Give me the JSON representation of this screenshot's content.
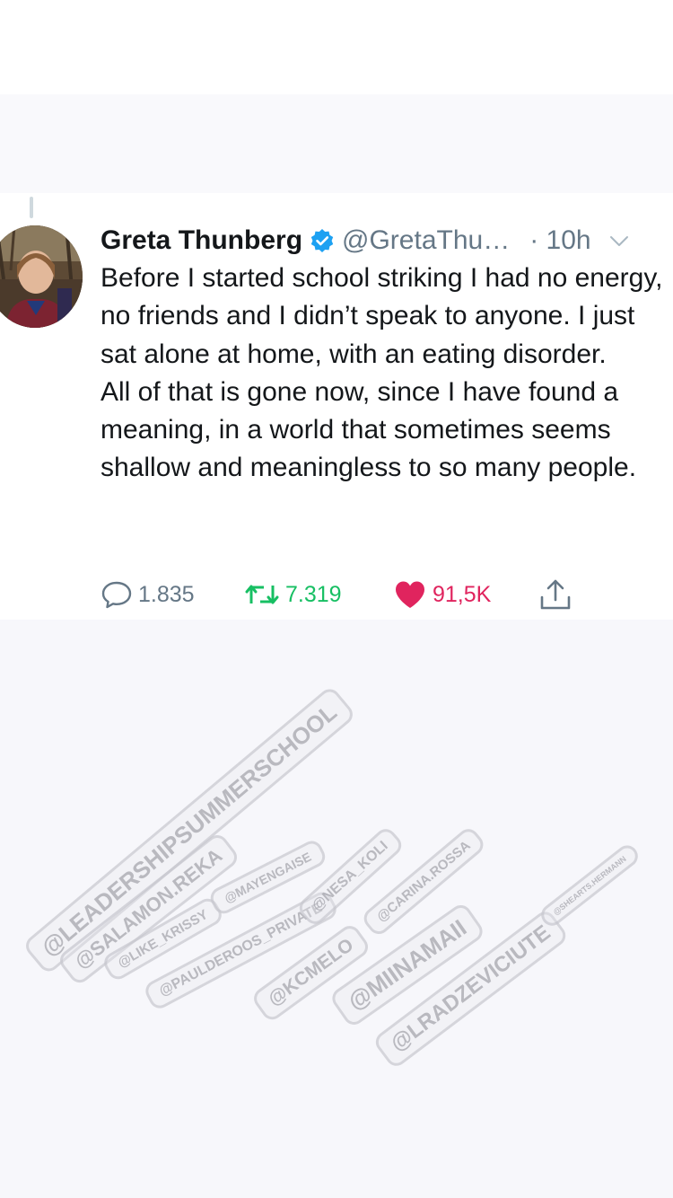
{
  "tweet": {
    "author_name": "Greta Thunberg",
    "handle": "@GretaThu…",
    "time": "· 10h",
    "text": "Before I started school striking I had no energy, no friends and I didn’t speak to anyone. I just sat alone at home, with an eating disorder.\nAll of that is gone now, since I have found a meaning, in a world that sometimes seems shallow and meaningless to so many people.",
    "replies": "1.835",
    "retweets": "7.319",
    "likes": "91,5K"
  },
  "icons": {
    "verified": "verified-badge-icon",
    "more": "chevron-down-icon",
    "reply": "reply-icon",
    "retweet": "retweet-icon",
    "like": "heart-icon",
    "share": "share-icon"
  },
  "colors": {
    "verified": "#1da1f2",
    "retweet": "#17bf63",
    "like": "#e0245e",
    "muted": "#657786"
  },
  "watermarks": [
    "@LEADERSHIPSUMMERSCHOOL",
    "@SALAMON.REKA",
    "@LIKE_KRISSY",
    "@MAYENGAISE",
    "@PAULDEROOS_PRIVATE",
    "@NESA_KOLI",
    "@KCMELO",
    "@CARINA.ROSSA",
    "@MIINAMAII",
    "@LRADZEVICIUTE",
    "@SHEARTS.HERMANN"
  ]
}
